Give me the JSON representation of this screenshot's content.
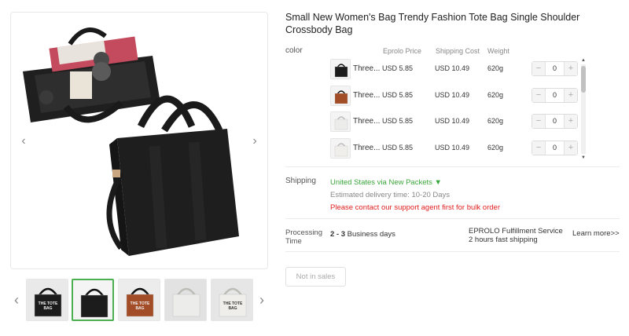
{
  "product": {
    "title": "Small New Women's Bag Trendy Fashion Tote Bag Single Shoulder Crossbody Bag"
  },
  "gallery": {
    "prev_icon": "chevron-left-icon",
    "next_icon": "chevron-right-icon",
    "thumb_prev_icon": "chevron-left-icon",
    "thumb_next_icon": "chevron-right-icon",
    "thumbnails": [
      {
        "text": "THE TOTE BAG",
        "bag_color": "#1c1c1c",
        "bg_color": "#e9e9e9",
        "active": false
      },
      {
        "text": "",
        "bag_color": "#1c1c1c",
        "bg_color": "#f4f4f4",
        "active": true
      },
      {
        "text": "THE TOTE BAG",
        "bag_color": "#a24d27",
        "bg_color": "#ececec",
        "active": false
      },
      {
        "text": "",
        "bag_color": "#ececea",
        "bg_color": "#e2e2e2",
        "active": false
      },
      {
        "text": "THE TOTE BAG",
        "bag_color": "#efeeea",
        "bg_color": "#e6e6e6",
        "active": false
      }
    ]
  },
  "variants": {
    "color_label": "color",
    "headers": {
      "price": "Eprolo Price",
      "shipping": "Shipping Cost",
      "weight": "Weight"
    },
    "rows": [
      {
        "name": "Three...",
        "price": "USD 5.85",
        "shipping": "USD 10.49",
        "weight": "620g",
        "qty": "0",
        "bag_color": "#1c1c1c"
      },
      {
        "name": "Three...",
        "price": "USD 5.85",
        "shipping": "USD 10.49",
        "weight": "620g",
        "qty": "0",
        "bag_color": "#a24d27"
      },
      {
        "name": "Three...",
        "price": "USD 5.85",
        "shipping": "USD 10.49",
        "weight": "620g",
        "qty": "0",
        "bag_color": "#ececea"
      },
      {
        "name": "Three...",
        "price": "USD 5.85",
        "shipping": "USD 10.49",
        "weight": "620g",
        "qty": "0",
        "bag_color": "#efeeea"
      }
    ],
    "minus": "−",
    "plus": "+",
    "scroll_up": "▲",
    "scroll_down": "▼"
  },
  "shipping": {
    "label": "Shipping",
    "method": "United States via New Packets ▼",
    "delivery": "Estimated delivery time: 10-20 Days",
    "warning": "Please contact our support agent first for bulk order"
  },
  "processing": {
    "label": "Processing Time",
    "days_range": "2 - 3",
    "days_suffix": " Business days",
    "fulfillment_title": "EPROLO Fulfillment Service",
    "fulfillment_subtitle": "2 hours fast shipping",
    "learn_more": "Learn more>>"
  },
  "actions": {
    "status_button": "Not in sales"
  },
  "colors": {
    "accent_green": "#3aa63a",
    "warning_red": "#e02020"
  }
}
